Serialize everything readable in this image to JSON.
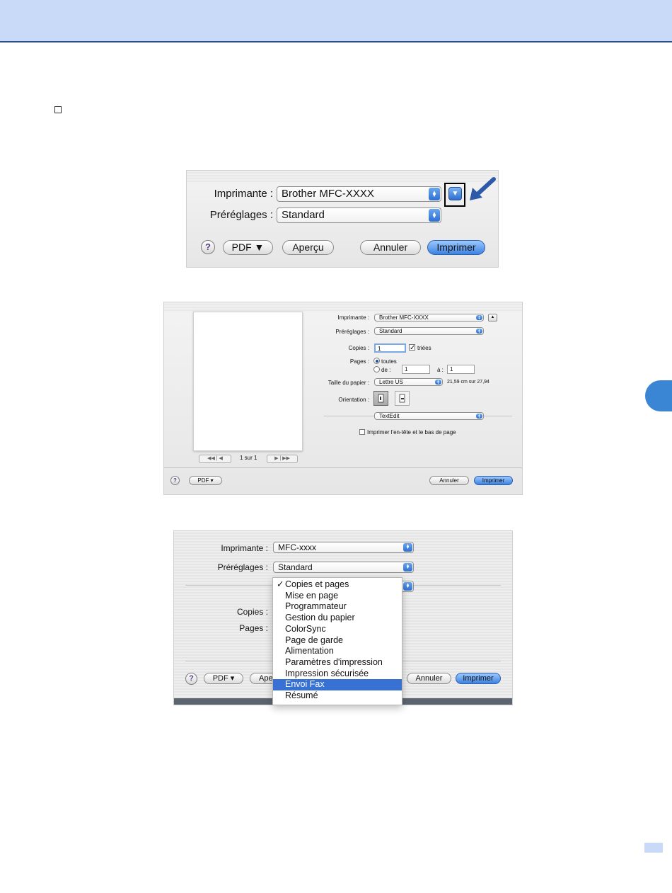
{
  "colors": {
    "header": "#c8daf8",
    "accent": "#3a86d4",
    "selection": "#3871d4"
  },
  "dialog_main": {
    "printer_label": "Imprimante :",
    "printer_value": "Brother MFC-XXXX",
    "presets_label": "Préréglages :",
    "presets_value": "Standard",
    "help_label": "?",
    "pdf_label": "PDF ▼",
    "preview_label": "Aperçu",
    "cancel_label": "Annuler",
    "print_label": "Imprimer"
  },
  "dialog_expanded": {
    "printer_label": "Imprimante :",
    "printer_value": "Brother MFC-XXXX",
    "presets_label": "Préréglages :",
    "presets_value": "Standard",
    "copies_label": "Copies :",
    "copies_value": "1",
    "collate_label": "triées",
    "pages_label": "Pages :",
    "pages_all_label": "toutes",
    "pages_from_label": "de :",
    "pages_from_value": "1",
    "pages_to_label": "à :",
    "pages_to_value": "1",
    "paper_label": "Taille du papier :",
    "paper_value": "Lettre US",
    "paper_size_text": "21,59 cm sur 27,94",
    "orientation_label": "Orientation :",
    "app_menu_value": "TextEdit",
    "header_footer_label": "Imprimer l'en-tête et le bas de page",
    "page_counter": "1 sur 1",
    "help_label": "?",
    "pdf_label": "PDF ▾",
    "cancel_label": "Annuler",
    "print_label": "Imprimer"
  },
  "dialog_menu": {
    "printer_label": "Imprimante :",
    "printer_value": "MFC-xxxx",
    "presets_label": "Préréglages :",
    "presets_value": "Standard",
    "copies_label": "Copies :",
    "pages_label": "Pages :",
    "help_label": "?",
    "pdf_label": "PDF ▾",
    "preview_partial": "Ape",
    "cancel_label": "Annuler",
    "print_label": "Imprimer",
    "checkmark": "✓",
    "menu_items": [
      {
        "label": "Copies et pages"
      },
      {
        "label": "Mise en page"
      },
      {
        "label": "Programmateur"
      },
      {
        "label": "Gestion du papier"
      },
      {
        "label": "ColorSync"
      },
      {
        "label": "Page de garde"
      },
      {
        "label": "Alimentation"
      },
      {
        "label": "Paramètres d'impression"
      },
      {
        "label": "Impression sécurisée"
      },
      {
        "label": "Envoi Fax"
      },
      {
        "label": "Résumé"
      }
    ]
  }
}
